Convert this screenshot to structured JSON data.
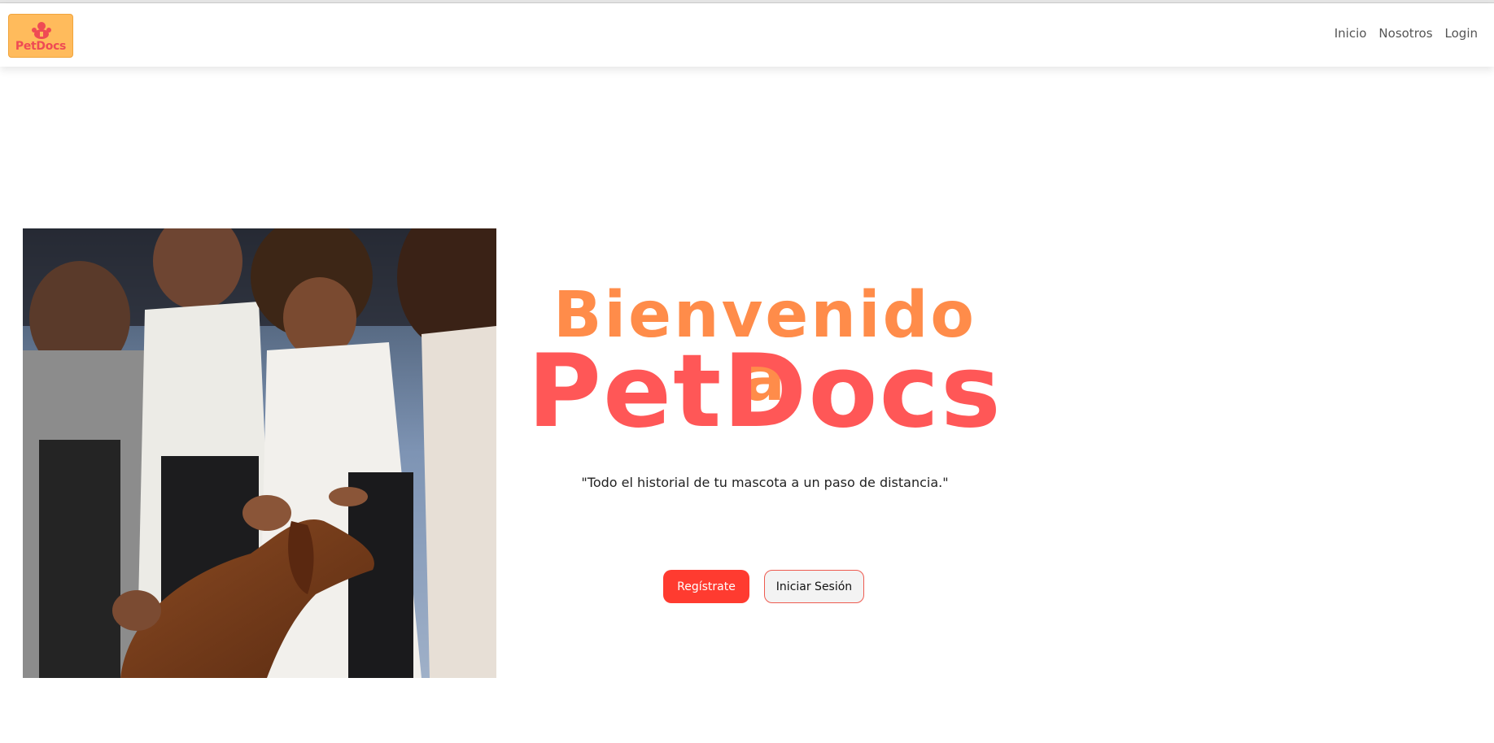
{
  "logo": {
    "text": "PetDocs"
  },
  "nav": {
    "items": [
      {
        "label": "Inicio"
      },
      {
        "label": "Nosotros"
      },
      {
        "label": "Login"
      }
    ]
  },
  "hero": {
    "heading_line1": "Bienvenido a",
    "heading_line2": "PetDocs",
    "tagline": "\"Todo el historial de tu mascota a un paso de distancia.\"",
    "buttons": {
      "register_label": "Regístrate",
      "login_label": "Iniciar Sesión"
    }
  },
  "colors": {
    "nav_text": "#555555",
    "heading_orange": "#ff8c4a",
    "heading_red": "#ff5757",
    "primary_button": "#ff3b30",
    "logo_background": "#ffbb5c"
  }
}
